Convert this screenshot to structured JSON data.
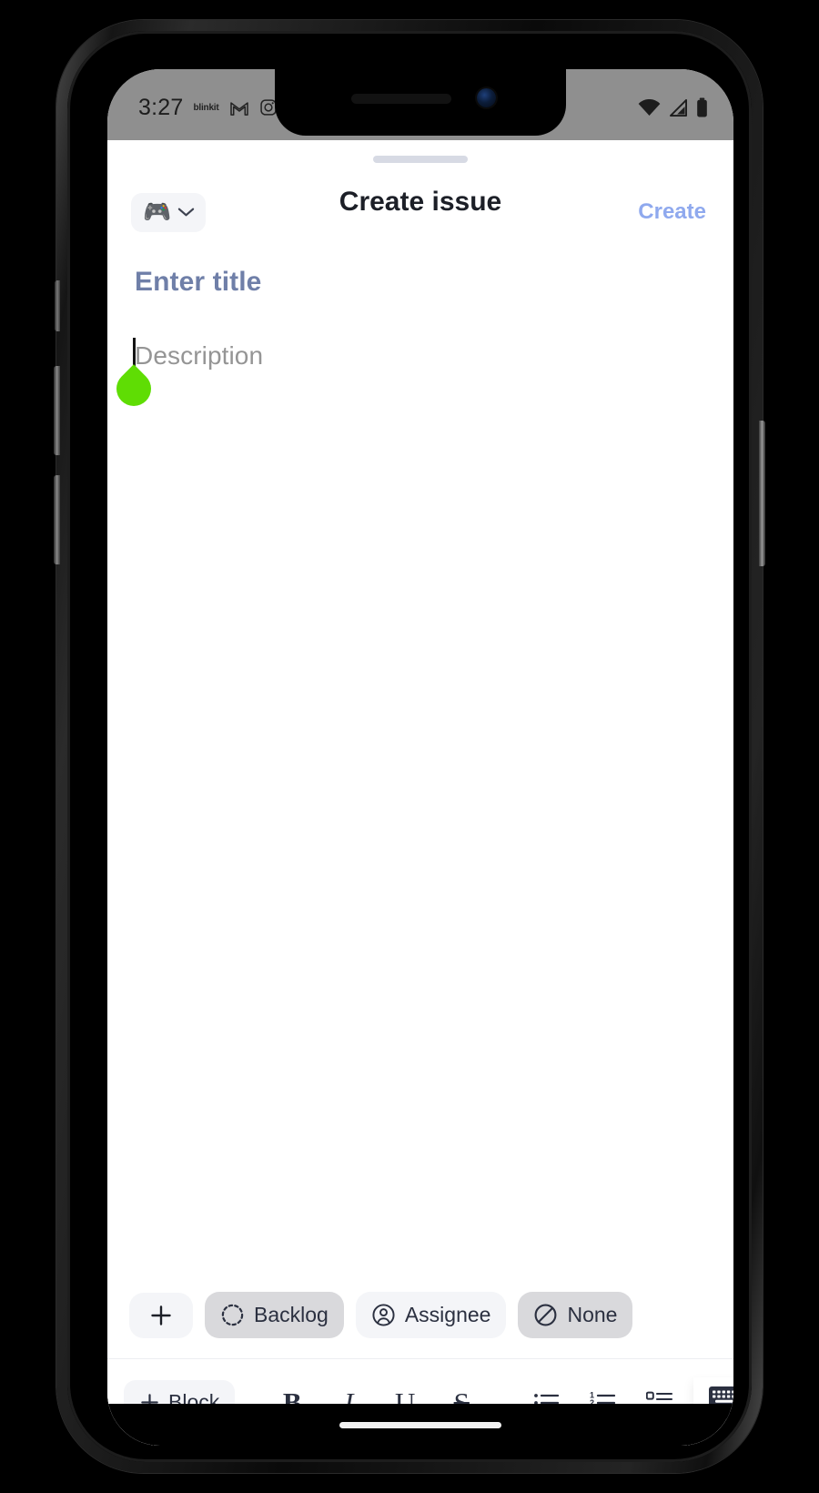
{
  "status_bar": {
    "time": "3:27",
    "app_label": "blinkit",
    "left_icons": [
      "gmail-icon",
      "instagram-icon"
    ],
    "right_icons": [
      "wifi-icon",
      "cellular-signal-icon",
      "battery-icon"
    ]
  },
  "header": {
    "project_emoji": "🎮",
    "project_chevron_icon": "chevron-down-icon",
    "title": "Create issue",
    "create_label": "Create",
    "create_color": "#8fa9ee"
  },
  "form": {
    "title_placeholder": "Enter title",
    "title_value": "",
    "title_color": "#6f7fa8",
    "description_placeholder": "Description",
    "description_value": "",
    "selection_handle_color": "#5fdd04"
  },
  "chips": [
    {
      "id": "add",
      "label": "+",
      "icon": "plus-icon",
      "style": "light"
    },
    {
      "id": "status",
      "label": "Backlog",
      "icon": "backlog-dashed-circle-icon",
      "style": "dark"
    },
    {
      "id": "assignee",
      "label": "Assignee",
      "icon": "person-circle-icon",
      "style": "light"
    },
    {
      "id": "priority",
      "label": "None",
      "icon": "no-priority-icon",
      "style": "dark"
    }
  ],
  "format_toolbar": {
    "block_label": "Block",
    "block_icon": "plus-icon",
    "bold_label": "B",
    "italic_label": "I",
    "underline_label": "U",
    "strikethrough_label": "S",
    "bullet_list_icon": "bullet-list-icon",
    "numbered_list_icon": "numbered-list-icon",
    "checklist_icon": "checklist-icon",
    "keyboard_hide_icon": "keyboard-hide-icon"
  }
}
